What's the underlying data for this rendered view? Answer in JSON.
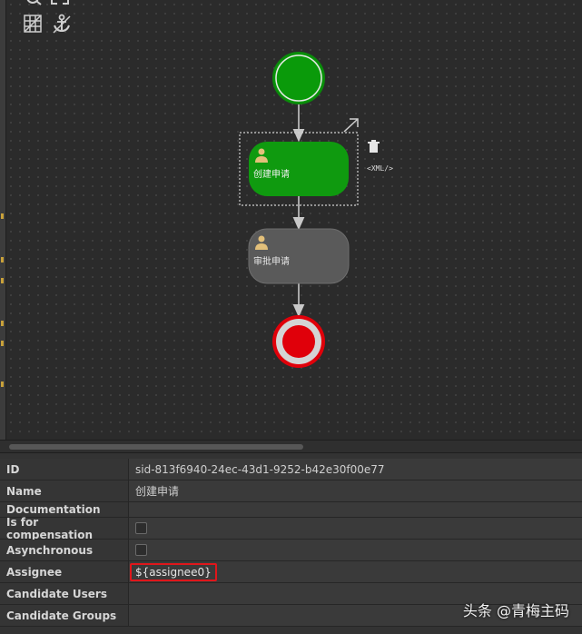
{
  "diagram": {
    "task1_label": "创建申请",
    "task2_label": "审批申请",
    "xml_label": "<XML/>",
    "colors": {
      "start_fill": "#0a9a0a",
      "task1_fill": "#0f9a0f",
      "task2_fill": "#5a5a5a",
      "end_fill": "#e0000a",
      "flow": "#c8c8c8"
    }
  },
  "properties": {
    "rows": [
      {
        "key": "ID",
        "value": "sid-813f6940-24ec-43d1-9252-b42e30f00e77"
      },
      {
        "key": "Name",
        "value": "创建申请"
      },
      {
        "key": "Documentation",
        "value": ""
      },
      {
        "key": "Is for compensation",
        "value": ""
      },
      {
        "key": "Asynchronous",
        "value": ""
      },
      {
        "key": "Assignee",
        "value": "${assignee0}"
      },
      {
        "key": "Candidate Users",
        "value": ""
      },
      {
        "key": "Candidate Groups",
        "value": ""
      }
    ]
  },
  "watermark": {
    "text": "头条 @青梅主码"
  }
}
